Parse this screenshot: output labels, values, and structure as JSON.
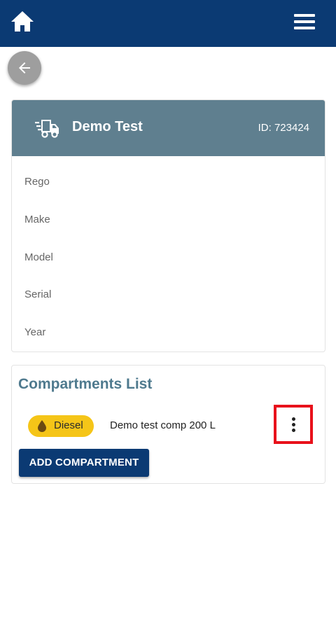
{
  "colors": {
    "topbar": "#0b3a73",
    "vehicle_header": "#5f7f8f",
    "section_title": "#4f7a8e",
    "fuel_chip": "#f5c518",
    "highlight_box": "#e8111b",
    "back_button": "#9e9e9e"
  },
  "topbar": {
    "home_icon": "home-icon",
    "menu_icon": "hamburger-menu-icon"
  },
  "back_button": {
    "icon": "arrow-left-icon"
  },
  "vehicle": {
    "icon": "truck-icon",
    "name": "Demo Test",
    "id_text": "ID: 723424",
    "fields": {
      "rego": "Rego",
      "make": "Make",
      "model": "Model",
      "serial": "Serial",
      "year": "Year"
    }
  },
  "compartments": {
    "title": "Compartments List",
    "items": [
      {
        "fuel_icon": "fuel-drop-icon",
        "fuel": "Diesel",
        "description": "Demo test comp 200 L",
        "menu_icon": "more-vertical-icon"
      }
    ],
    "add_label": "ADD COMPARTMENT"
  }
}
